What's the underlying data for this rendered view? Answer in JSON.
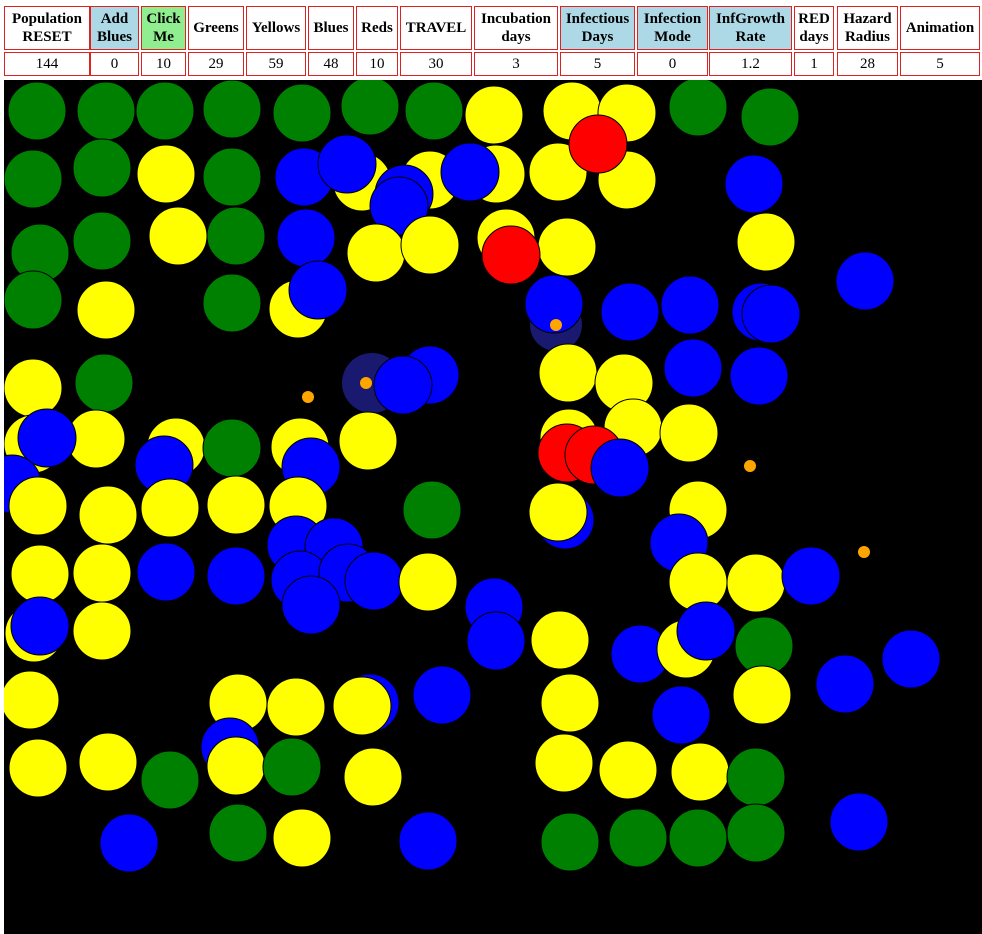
{
  "controls": [
    {
      "key": "population",
      "label": "Population\nRESET",
      "value": "144",
      "bg": "#ffffff"
    },
    {
      "key": "add_blues",
      "label": "Add\nBlues",
      "value": "0",
      "bg": "#add8e6"
    },
    {
      "key": "click_me",
      "label": "Click\nMe",
      "value": "10",
      "bg": "#90ee90"
    },
    {
      "key": "greens",
      "label": "Greens",
      "value": "29",
      "bg": "#ffffff"
    },
    {
      "key": "yellows",
      "label": "Yellows",
      "value": "59",
      "bg": "#ffffff"
    },
    {
      "key": "blues",
      "label": "Blues",
      "value": "48",
      "bg": "#ffffff"
    },
    {
      "key": "reds",
      "label": "Reds",
      "value": "10",
      "bg": "#ffffff"
    },
    {
      "key": "travel",
      "label": "TRAVEL",
      "value": "30",
      "bg": "#ffffff"
    },
    {
      "key": "incubation_days",
      "label": "Incubation\ndays",
      "value": "3",
      "bg": "#ffffff"
    },
    {
      "key": "infectious_days",
      "label": "Infectious\nDays",
      "value": "5",
      "bg": "#add8e6"
    },
    {
      "key": "infection_mode",
      "label": "Infection\nMode",
      "value": "0",
      "bg": "#add8e6"
    },
    {
      "key": "inf_growth_rate",
      "label": "InfGrowth\nRate",
      "value": "1.2",
      "bg": "#add8e6"
    },
    {
      "key": "red_days",
      "label": "RED\ndays",
      "value": "1",
      "bg": "#ffffff"
    },
    {
      "key": "hazard_radius",
      "label": "Hazard\nRadius",
      "value": "28",
      "bg": "#ffffff"
    },
    {
      "key": "animation",
      "label": "Animation",
      "value": "5",
      "bg": "#ffffff"
    }
  ],
  "arena": {
    "background": "#000000",
    "colors": {
      "green": "#008000",
      "yellow": "#ffff00",
      "blue": "#0000ff",
      "red": "#ff0000",
      "hazard_dot": "#ffa500",
      "hazard_zone": "#191970"
    }
  }
}
